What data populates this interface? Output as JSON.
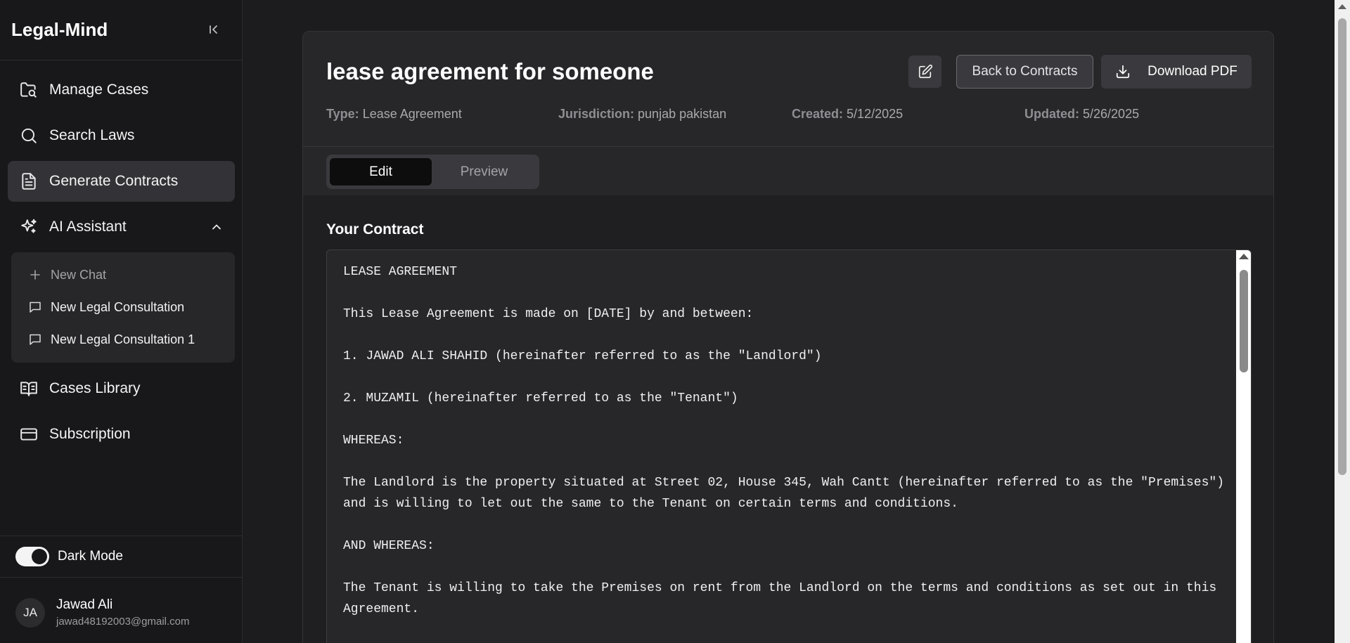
{
  "sidebar": {
    "brand": "Legal-Mind",
    "nav": [
      {
        "label": "Manage Cases",
        "icon": "folder-search-icon"
      },
      {
        "label": "Search Laws",
        "icon": "search-icon"
      },
      {
        "label": "Generate Contracts",
        "icon": "document-icon",
        "active": true
      },
      {
        "label": "AI Assistant",
        "icon": "sparkles-icon",
        "expanded": true
      }
    ],
    "ai_sub": {
      "new_chat": "New Chat",
      "chats": [
        "New Legal Consultation",
        "New Legal Consultation 1"
      ]
    },
    "nav_bottom": [
      {
        "label": "Cases Library",
        "icon": "book-open-icon"
      },
      {
        "label": "Subscription",
        "icon": "credit-card-icon"
      }
    ],
    "dark_mode_label": "Dark Mode",
    "dark_mode_on": true,
    "user": {
      "initials": "JA",
      "name": "Jawad Ali",
      "email": "jawad48192003@gmail.com"
    }
  },
  "contract": {
    "title": "lease agreement for someone",
    "back_label": "Back to Contracts",
    "download_label": "Download PDF",
    "meta": {
      "type_label": "Type:",
      "type_value": "Lease Agreement",
      "jurisdiction_label": "Jurisdiction:",
      "jurisdiction_value": "punjab pakistan",
      "created_label": "Created:",
      "created_value": "5/12/2025",
      "updated_label": "Updated:",
      "updated_value": "5/26/2025"
    },
    "tabs": {
      "edit": "Edit",
      "preview": "Preview",
      "active": "Edit"
    },
    "section_title": "Your Contract",
    "body": "LEASE AGREEMENT\n\nThis Lease Agreement is made on [DATE] by and between:\n\n1. JAWAD ALI SHAHID (hereinafter referred to as the \"Landlord\")\n\n2. MUZAMIL (hereinafter referred to as the \"Tenant\")\n\nWHEREAS:\n\nThe Landlord is the property situated at Street 02, House 345, Wah Cantt (hereinafter referred to as the \"Premises\") and is willing to let out the same to the Tenant on certain terms and conditions.\n\nAND WHEREAS:\n\nThe Tenant is willing to take the Premises on rent from the Landlord on the terms and conditions as set out in this Agreement."
  },
  "colors": {
    "background": "#1c1c1e",
    "sidebar": "#18181a",
    "card": "#27272a",
    "active_nav": "#333337",
    "text": "#f2f2f2"
  }
}
